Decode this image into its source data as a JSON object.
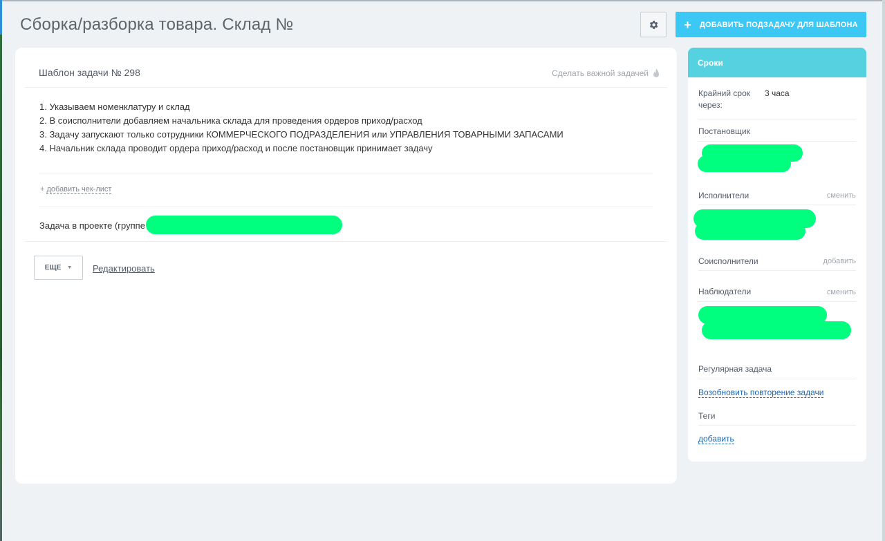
{
  "header": {
    "title": "Сборка/разборка товара. Склад №",
    "add_subtask_label": "ДОБАВИТЬ ПОДЗАДАЧУ ДЛЯ ШАБЛОНА"
  },
  "task": {
    "template_title": "Шаблон задачи № 298",
    "make_important": "Сделать важной задачей",
    "description": [
      "1. Указываем номенклатуру и склад",
      "2. В соисполнители добавляем начальника склада для проведения ордеров приход/расход",
      "3. Задачу запускают только сотрудники КОММЕРЧЕСКОГО ПОДРАЗДЕЛЕНИЯ или УПРАВЛЕНИЯ ТОВАРНЫМИ ЗАПАСАМИ",
      "4. Начальник склада проводит ордера приход/расход и после постановщик принимает задачу"
    ],
    "add_checklist": "добавить чек-лист",
    "project_label": "Задача в проекте (группе",
    "more_label": "ЕЩЕ",
    "edit_label": "Редактировать"
  },
  "sidebar": {
    "header": "Сроки",
    "deadline_label": "Крайний срок через:",
    "deadline_value": "3 часа",
    "creator_label": "Постановщик",
    "assignees_label": "Исполнители",
    "assignees_action": "сменить",
    "coexec_label": "Соисполнители",
    "coexec_action": "добавить",
    "observers_label": "Наблюдатели",
    "observers_action": "сменить",
    "regular_label": "Регулярная задача",
    "resume_link": "Возобновить повторение задачи",
    "tags_label": "Теги",
    "tags_add": "добавить"
  },
  "colors": {
    "accent": "#3bc8f5",
    "sidebar_header": "#56d1e0",
    "redaction": "#00ff7f"
  }
}
